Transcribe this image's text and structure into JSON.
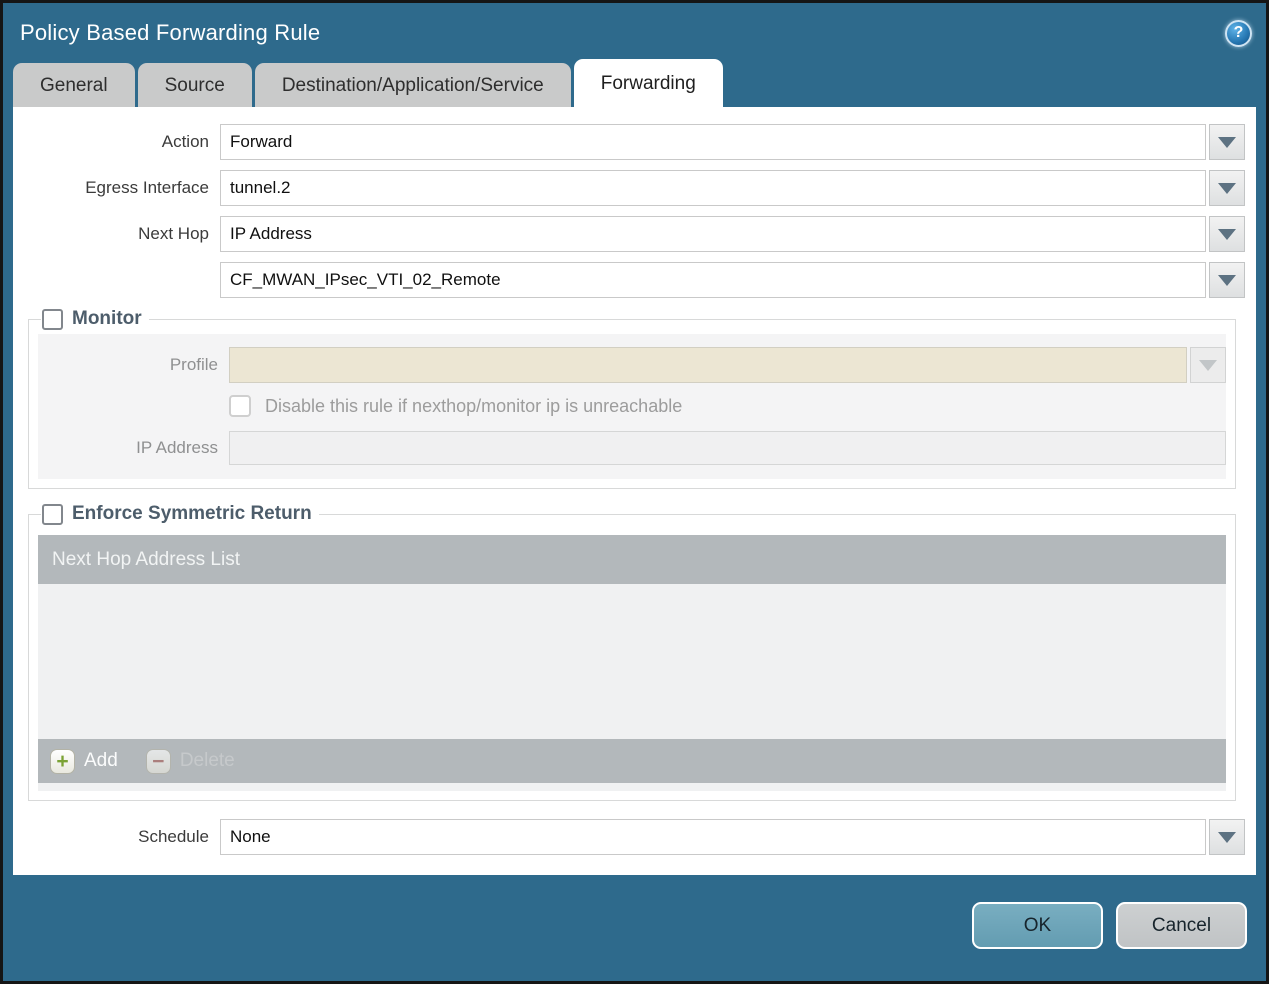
{
  "window": {
    "title": "Policy Based Forwarding Rule",
    "help_glyph": "?"
  },
  "tabs": [
    {
      "label": "General",
      "active": false
    },
    {
      "label": "Source",
      "active": false
    },
    {
      "label": "Destination/Application/Service",
      "active": false
    },
    {
      "label": "Forwarding",
      "active": true
    }
  ],
  "form": {
    "action": {
      "label": "Action",
      "value": "Forward"
    },
    "egress_interface": {
      "label": "Egress Interface",
      "value": "tunnel.2"
    },
    "next_hop": {
      "label": "Next Hop",
      "value": "IP Address"
    },
    "next_hop_address": {
      "value": "CF_MWAN_IPsec_VTI_02_Remote"
    },
    "schedule": {
      "label": "Schedule",
      "value": "None"
    }
  },
  "monitor": {
    "title": "Monitor",
    "checked": false,
    "profile": {
      "label": "Profile",
      "value": ""
    },
    "disable_rule": {
      "label": "Disable this rule if nexthop/monitor ip is unreachable",
      "checked": false
    },
    "ip_address": {
      "label": "IP Address",
      "value": ""
    }
  },
  "symmetric_return": {
    "title": "Enforce Symmetric Return",
    "checked": false,
    "table": {
      "header": "Next Hop Address List",
      "rows": []
    },
    "add_label": "Add",
    "delete_label": "Delete",
    "add_glyph": "+",
    "delete_glyph": "−"
  },
  "footer": {
    "ok_label": "OK",
    "cancel_label": "Cancel"
  },
  "colors": {
    "window_bg": "#2e6a8c",
    "tab_inactive_bg": "#c9caca",
    "tab_active_bg": "#ffffff",
    "table_gray": "#b3b8bb",
    "disabled_field_cream": "#ece6d3",
    "ok_button": "#6ea8bc",
    "cancel_button": "#c7cacc",
    "add_plus_green": "#7ba235",
    "delete_minus_red": "#a8625c"
  }
}
